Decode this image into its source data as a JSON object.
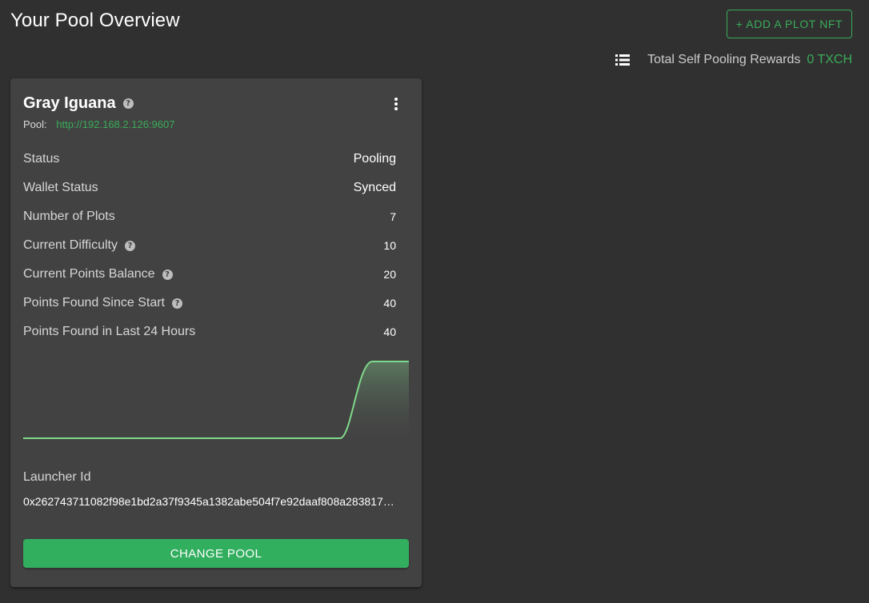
{
  "header": {
    "title": "Your Pool Overview",
    "add_plot_nft_label": "+ ADD A PLOT NFT",
    "rewards_label": "Total Self Pooling Rewards",
    "rewards_value": "0 TXCH",
    "list_icon": "list-icon"
  },
  "card": {
    "name": "Gray Iguana",
    "pool_label": "Pool:",
    "pool_url": "http://192.168.2.126:9607",
    "stats": [
      {
        "label": "Status",
        "value": "Pooling",
        "help": false
      },
      {
        "label": "Wallet Status",
        "value": "Synced",
        "help": false
      },
      {
        "label": "Number of Plots",
        "value": "7",
        "help": false
      },
      {
        "label": "Current Difficulty",
        "value": "10",
        "help": true
      },
      {
        "label": "Current Points Balance",
        "value": "20",
        "help": true
      },
      {
        "label": "Points Found Since Start",
        "value": "40",
        "help": true
      },
      {
        "label": "Points Found in Last 24 Hours",
        "value": "40",
        "help": false
      }
    ],
    "launcher_label": "Launcher Id",
    "launcher_id": "0x262743711082f98e1bd2a37f9345a1382abe504f7e92daaf808a283817…",
    "change_pool_label": "CHANGE POOL",
    "help_glyph": "?"
  },
  "colors": {
    "accent": "#3aac59",
    "button": "#32ae5f",
    "background": "#303030",
    "card": "#424242"
  }
}
